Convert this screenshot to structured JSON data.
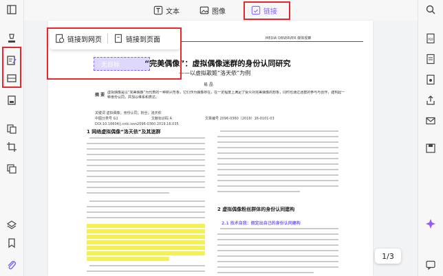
{
  "toolbar": {
    "text_label": "文本",
    "image_label": "图像",
    "link_label": "链接"
  },
  "popup": {
    "link_web_label": "链接到网页",
    "link_page_label": "链接到页面"
  },
  "selection": {
    "label": "无目标"
  },
  "document": {
    "header_right": "MEDIA OBSERVER 媒体观察",
    "title_a": "“完美偶像”：虚拟偶像迷群的身份认同研究",
    "subtitle": "——以虚拟歌姬“洛天依”为例",
    "author": "易 晶",
    "abstract_head": "摘 要",
    "abstract_text": "虚拟偶像是以“完美偶像”为代表的一种新兴形象，它们作为偶像存在，在一定程度上满足了受众对完美偶像的想象，同时也通过迷群的参与与创作，建构起一种身份认同，并加以维系和表达。",
    "keywords": "关键词 虚拟偶像；身份认同；粉丝；洛天依",
    "class_no": "中图分类号 G2",
    "doc_code": "文献标识码 A",
    "article_no": "文章编号 2096-0360（2019）16-0101-03",
    "doi": "DOI:10.16604/j.cnki.issn2096-0360.2019.16.035",
    "section1": "1 网络虚拟偶像“洛天依”及其迷群",
    "section2": "2 虚拟偶像粉丝群体的身份认同建构",
    "section21": "2.1 技术自我：假定出自己的身份认同建构"
  },
  "page_indicator": "1/3",
  "colors": {
    "accent": "#7d63f2",
    "highlight": "#f4f056",
    "annotation": "#e8262b"
  }
}
